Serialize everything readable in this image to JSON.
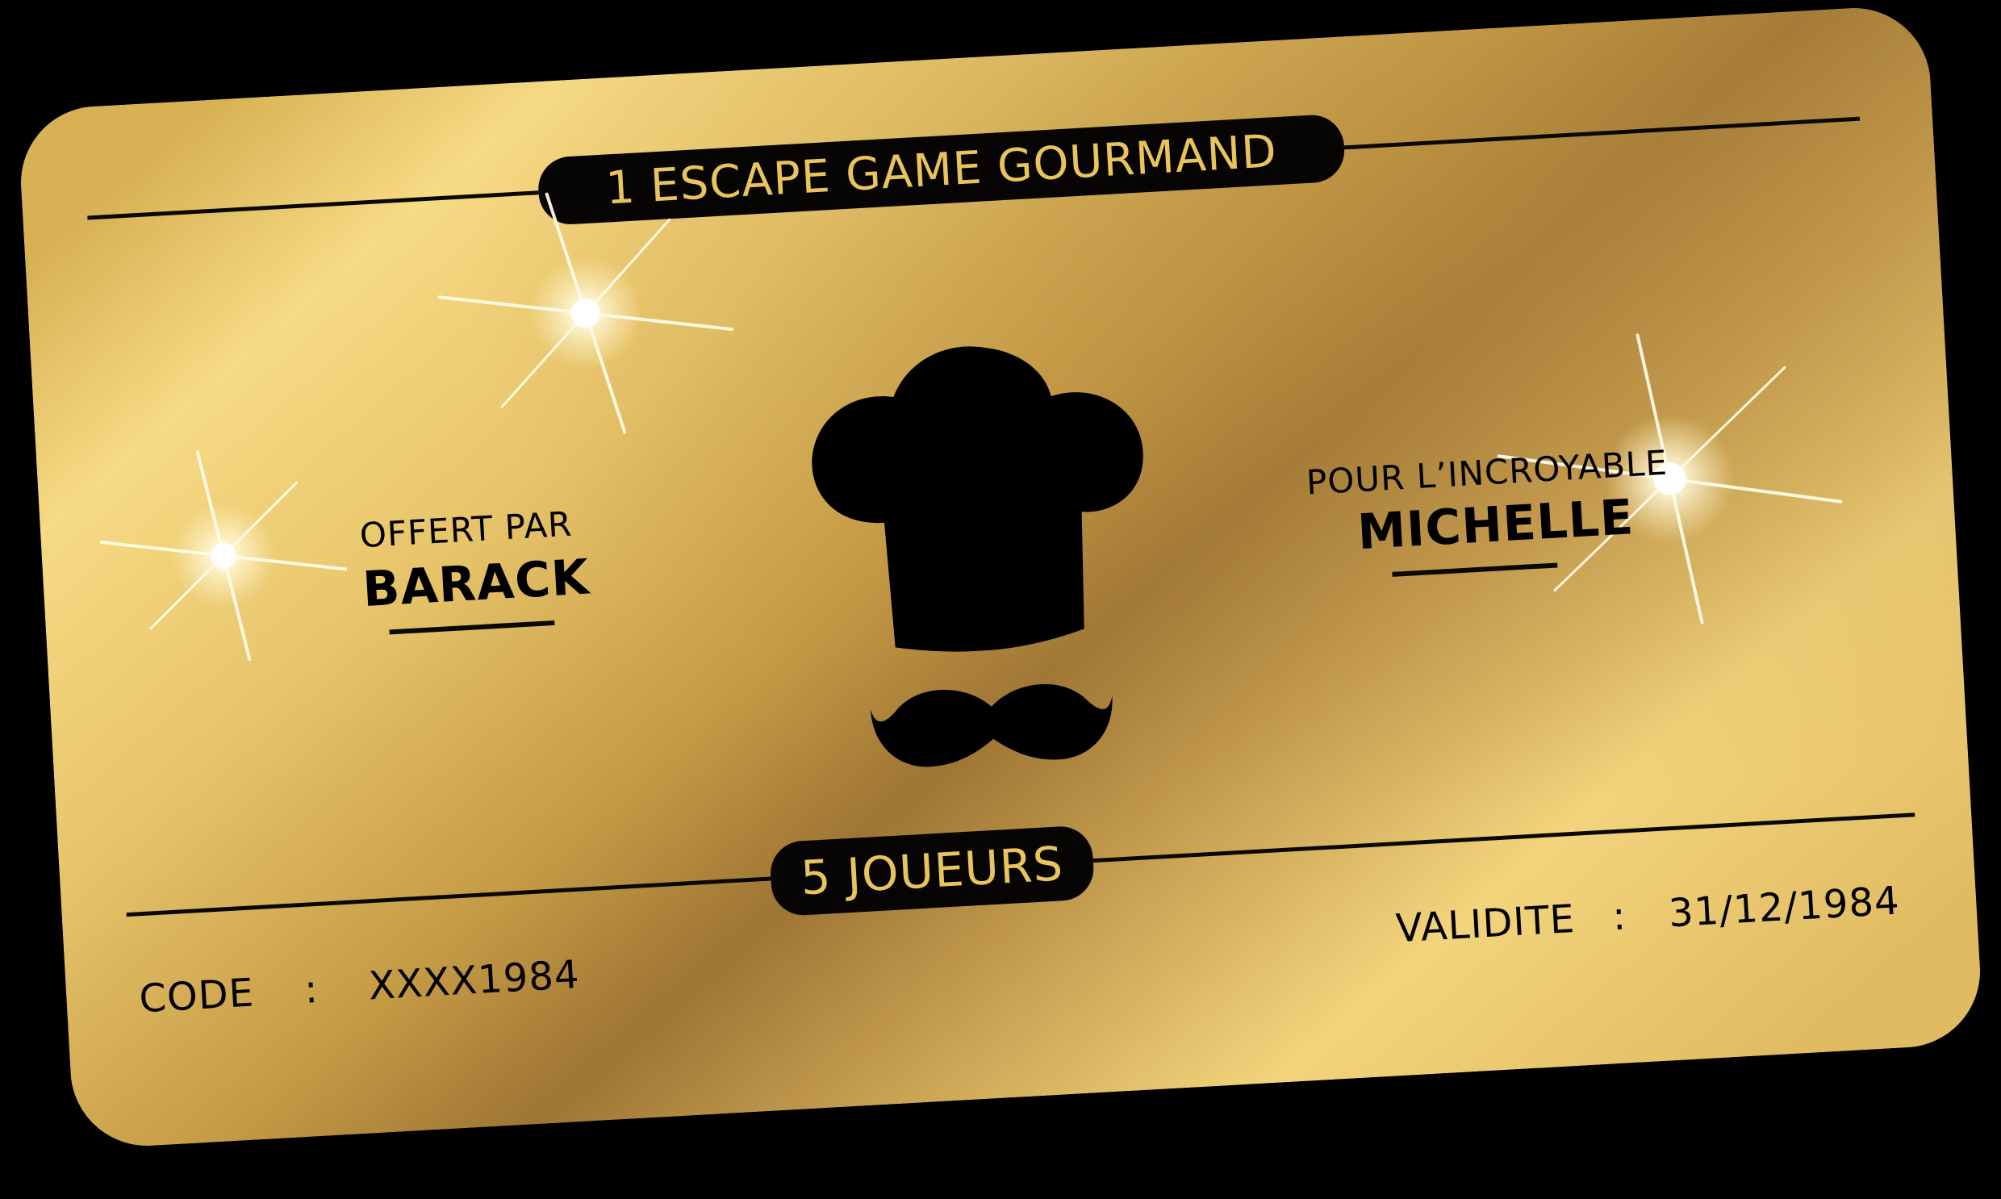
{
  "card": {
    "title": "1 ESCAPE GAME GOURMAND",
    "offered_label": "OFFERT PAR",
    "offered_by": "BARACK",
    "recipient_label": "POUR L’INCROYABLE",
    "recipient": "MICHELLE",
    "players": "5 JOUEURS",
    "code_label": "CODE",
    "code_sep": ":",
    "code_value": "XXXX1984",
    "validity_label": "VALIDITE",
    "validity_sep": ":",
    "validity_value": "31/12/1984"
  },
  "icons": {
    "hat": "chef-hat-icon",
    "mustache": "mustache-icon",
    "sparkle": "sparkle-icon"
  },
  "colors": {
    "gold_light": "#f4d67e",
    "gold_dark": "#9e7432",
    "ink": "#000000",
    "pill_text": "#e9c35c",
    "background": "#000000"
  }
}
